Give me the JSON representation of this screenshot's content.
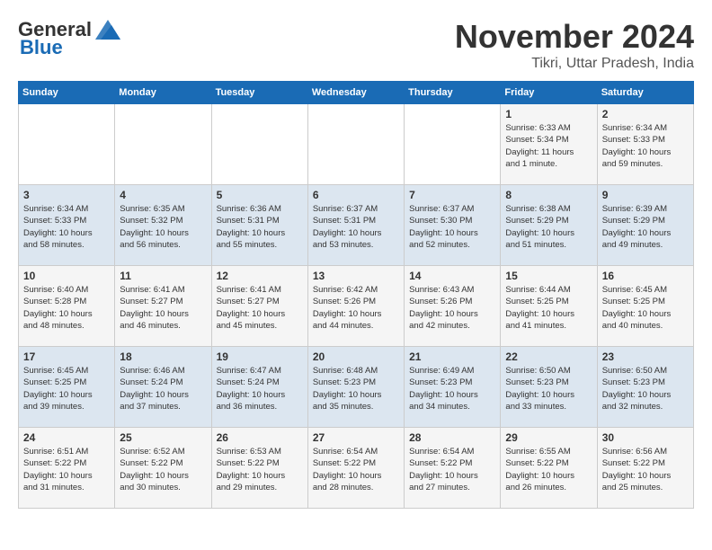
{
  "header": {
    "logo_line1": "General",
    "logo_line2": "Blue",
    "month_title": "November 2024",
    "location": "Tikri, Uttar Pradesh, India"
  },
  "days_of_week": [
    "Sunday",
    "Monday",
    "Tuesday",
    "Wednesday",
    "Thursday",
    "Friday",
    "Saturday"
  ],
  "weeks": [
    [
      {
        "day": "",
        "info": ""
      },
      {
        "day": "",
        "info": ""
      },
      {
        "day": "",
        "info": ""
      },
      {
        "day": "",
        "info": ""
      },
      {
        "day": "",
        "info": ""
      },
      {
        "day": "1",
        "info": "Sunrise: 6:33 AM\nSunset: 5:34 PM\nDaylight: 11 hours\nand 1 minute."
      },
      {
        "day": "2",
        "info": "Sunrise: 6:34 AM\nSunset: 5:33 PM\nDaylight: 10 hours\nand 59 minutes."
      }
    ],
    [
      {
        "day": "3",
        "info": "Sunrise: 6:34 AM\nSunset: 5:33 PM\nDaylight: 10 hours\nand 58 minutes."
      },
      {
        "day": "4",
        "info": "Sunrise: 6:35 AM\nSunset: 5:32 PM\nDaylight: 10 hours\nand 56 minutes."
      },
      {
        "day": "5",
        "info": "Sunrise: 6:36 AM\nSunset: 5:31 PM\nDaylight: 10 hours\nand 55 minutes."
      },
      {
        "day": "6",
        "info": "Sunrise: 6:37 AM\nSunset: 5:31 PM\nDaylight: 10 hours\nand 53 minutes."
      },
      {
        "day": "7",
        "info": "Sunrise: 6:37 AM\nSunset: 5:30 PM\nDaylight: 10 hours\nand 52 minutes."
      },
      {
        "day": "8",
        "info": "Sunrise: 6:38 AM\nSunset: 5:29 PM\nDaylight: 10 hours\nand 51 minutes."
      },
      {
        "day": "9",
        "info": "Sunrise: 6:39 AM\nSunset: 5:29 PM\nDaylight: 10 hours\nand 49 minutes."
      }
    ],
    [
      {
        "day": "10",
        "info": "Sunrise: 6:40 AM\nSunset: 5:28 PM\nDaylight: 10 hours\nand 48 minutes."
      },
      {
        "day": "11",
        "info": "Sunrise: 6:41 AM\nSunset: 5:27 PM\nDaylight: 10 hours\nand 46 minutes."
      },
      {
        "day": "12",
        "info": "Sunrise: 6:41 AM\nSunset: 5:27 PM\nDaylight: 10 hours\nand 45 minutes."
      },
      {
        "day": "13",
        "info": "Sunrise: 6:42 AM\nSunset: 5:26 PM\nDaylight: 10 hours\nand 44 minutes."
      },
      {
        "day": "14",
        "info": "Sunrise: 6:43 AM\nSunset: 5:26 PM\nDaylight: 10 hours\nand 42 minutes."
      },
      {
        "day": "15",
        "info": "Sunrise: 6:44 AM\nSunset: 5:25 PM\nDaylight: 10 hours\nand 41 minutes."
      },
      {
        "day": "16",
        "info": "Sunrise: 6:45 AM\nSunset: 5:25 PM\nDaylight: 10 hours\nand 40 minutes."
      }
    ],
    [
      {
        "day": "17",
        "info": "Sunrise: 6:45 AM\nSunset: 5:25 PM\nDaylight: 10 hours\nand 39 minutes."
      },
      {
        "day": "18",
        "info": "Sunrise: 6:46 AM\nSunset: 5:24 PM\nDaylight: 10 hours\nand 37 minutes."
      },
      {
        "day": "19",
        "info": "Sunrise: 6:47 AM\nSunset: 5:24 PM\nDaylight: 10 hours\nand 36 minutes."
      },
      {
        "day": "20",
        "info": "Sunrise: 6:48 AM\nSunset: 5:23 PM\nDaylight: 10 hours\nand 35 minutes."
      },
      {
        "day": "21",
        "info": "Sunrise: 6:49 AM\nSunset: 5:23 PM\nDaylight: 10 hours\nand 34 minutes."
      },
      {
        "day": "22",
        "info": "Sunrise: 6:50 AM\nSunset: 5:23 PM\nDaylight: 10 hours\nand 33 minutes."
      },
      {
        "day": "23",
        "info": "Sunrise: 6:50 AM\nSunset: 5:23 PM\nDaylight: 10 hours\nand 32 minutes."
      }
    ],
    [
      {
        "day": "24",
        "info": "Sunrise: 6:51 AM\nSunset: 5:22 PM\nDaylight: 10 hours\nand 31 minutes."
      },
      {
        "day": "25",
        "info": "Sunrise: 6:52 AM\nSunset: 5:22 PM\nDaylight: 10 hours\nand 30 minutes."
      },
      {
        "day": "26",
        "info": "Sunrise: 6:53 AM\nSunset: 5:22 PM\nDaylight: 10 hours\nand 29 minutes."
      },
      {
        "day": "27",
        "info": "Sunrise: 6:54 AM\nSunset: 5:22 PM\nDaylight: 10 hours\nand 28 minutes."
      },
      {
        "day": "28",
        "info": "Sunrise: 6:54 AM\nSunset: 5:22 PM\nDaylight: 10 hours\nand 27 minutes."
      },
      {
        "day": "29",
        "info": "Sunrise: 6:55 AM\nSunset: 5:22 PM\nDaylight: 10 hours\nand 26 minutes."
      },
      {
        "day": "30",
        "info": "Sunrise: 6:56 AM\nSunset: 5:22 PM\nDaylight: 10 hours\nand 25 minutes."
      }
    ]
  ]
}
